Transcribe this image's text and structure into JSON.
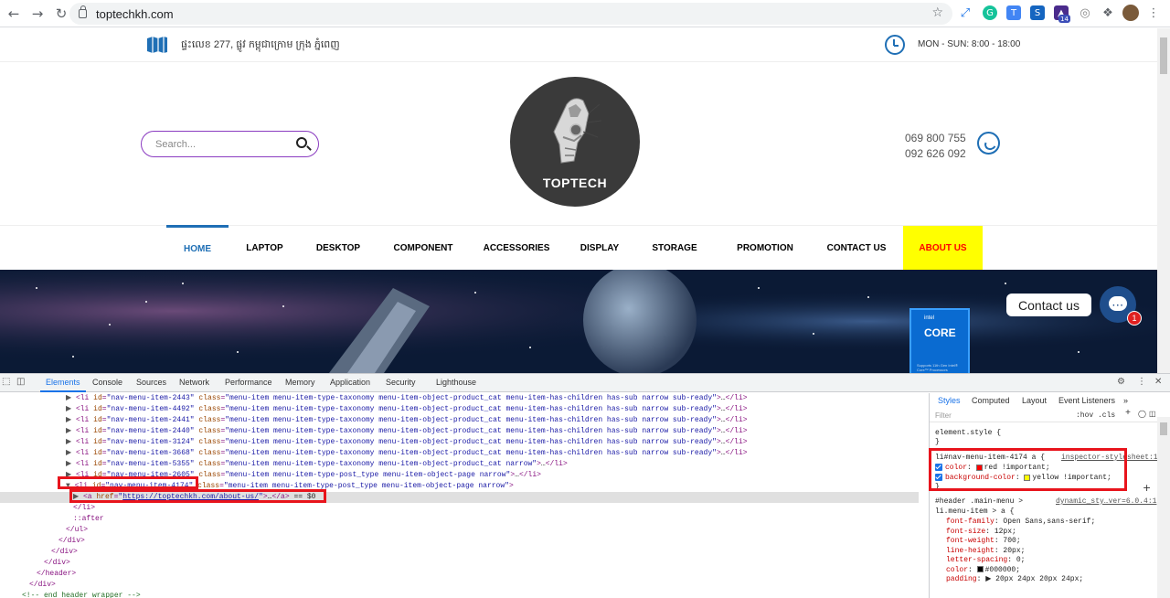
{
  "browser": {
    "url": "toptechkh.com",
    "extension_badge": "14"
  },
  "topbar": {
    "address": "ផ្ទះលេខ 277, ផ្លូវ កម្ពុជាក្រោម ក្រុង ភ្នំពេញ",
    "hours": "MON - SUN: 8:00 - 18:00"
  },
  "header": {
    "search_placeholder": "Search...",
    "logo_text": "TOPTECH",
    "phone1": "069 800 755",
    "phone2": "092 626 092"
  },
  "nav": {
    "items": [
      "HOME",
      "LAPTOP",
      "DESKTOP",
      "COMPONENT",
      "ACCESSORIES",
      "DISPLAY",
      "STORAGE",
      "PROMOTION",
      "CONTACT US",
      "ABOUT US"
    ]
  },
  "banner": {
    "chip_brand": "intel",
    "chip_name": "CORE",
    "chip_note": "Supports 11th Gen Intel® Core™ Processors",
    "contact_label": "Contact us",
    "badge_count": "1"
  },
  "devtools": {
    "tabs": [
      "Elements",
      "Console",
      "Sources",
      "Network",
      "Performance",
      "Memory",
      "Application",
      "Security",
      "Lighthouse"
    ],
    "elements": [
      {
        "id": "nav-menu-item-2443",
        "cls": "menu-item menu-item-type-taxonomy menu-item-object-product_cat menu-item-has-children has-sub narrow sub-ready"
      },
      {
        "id": "nav-menu-item-4492",
        "cls": "menu-item menu-item-type-taxonomy menu-item-object-product_cat menu-item-has-children has-sub narrow sub-ready"
      },
      {
        "id": "nav-menu-item-2441",
        "cls": "menu-item menu-item-type-taxonomy menu-item-object-product_cat menu-item-has-children has-sub narrow sub-ready"
      },
      {
        "id": "nav-menu-item-2440",
        "cls": "menu-item menu-item-type-taxonomy menu-item-object-product_cat menu-item-has-children has-sub narrow sub-ready"
      },
      {
        "id": "nav-menu-item-3124",
        "cls": "menu-item menu-item-type-taxonomy menu-item-object-product_cat menu-item-has-children has-sub narrow sub-ready"
      },
      {
        "id": "nav-menu-item-3668",
        "cls": "menu-item menu-item-type-taxonomy menu-item-object-product_cat menu-item-has-children has-sub narrow sub-ready"
      },
      {
        "id": "nav-menu-item-5355",
        "cls": "menu-item menu-item-type-taxonomy menu-item-object-product_cat narrow"
      },
      {
        "id": "nav-menu-item-2605",
        "cls": "menu-item menu-item-type-post_type menu-item-object-page narrow"
      },
      {
        "id": "nav-menu-item-4174",
        "cls": "menu-item menu-item-type-post_type menu-item-object-page narrow"
      }
    ],
    "selected_href": "https://toptechkh.com/about-us/",
    "selected_suffix": "== $0",
    "closing": [
      "</li>",
      "::after",
      "</ul>",
      "</div>",
      "</div>",
      "</div>",
      "</header>",
      "</div>",
      "<!-- end header wrapper -->"
    ],
    "styles_tabs": [
      "Styles",
      "Computed",
      "Layout",
      "Event Listeners"
    ],
    "filter_placeholder": "Filter",
    "filter_buttons": ":hov  .cls",
    "element_style": "element.style {",
    "rule1": {
      "selector": "li#nav-menu-item-4174 a {",
      "source": "inspector-stylesheet:1",
      "p1_name": "color",
      "p1_value": "red !important;",
      "p1_color": "#ff0000",
      "p2_name": "background-color",
      "p2_value": "yellow !important;",
      "p2_color": "#ffff00"
    },
    "rule2": {
      "selector_line1": "#header .main-menu >",
      "selector_line2": "li.menu-item > a {",
      "source": "dynamic_sty…ver=6.0.4:1",
      "props": [
        {
          "name": "font-family",
          "value": "Open Sans,sans-serif;"
        },
        {
          "name": "font-size",
          "value": "12px;"
        },
        {
          "name": "font-weight",
          "value": "700;"
        },
        {
          "name": "line-height",
          "value": "20px;"
        },
        {
          "name": "letter-spacing",
          "value": "0;"
        },
        {
          "name": "color",
          "value": "#000000;"
        },
        {
          "name": "padding",
          "value": "20px 24px 20px 24px;"
        }
      ]
    }
  }
}
